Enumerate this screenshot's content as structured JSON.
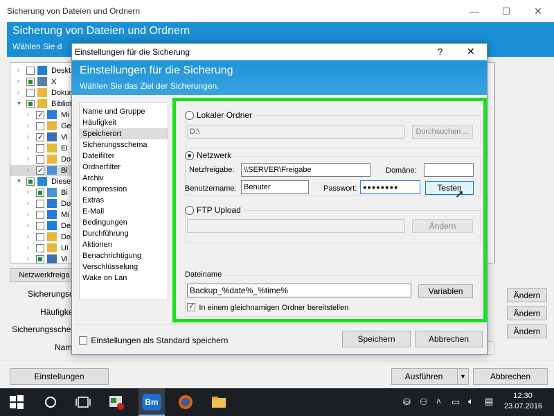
{
  "main": {
    "title": "Sicherung von Dateien und Ordnern",
    "header_title": "Sicherung von Dateien und Ordnern",
    "header_sub": "Wählen Sie d",
    "tree": [
      {
        "label": "Deskt",
        "state": "empty",
        "icon": "desktop-icon"
      },
      {
        "label": "X",
        "state": "fill",
        "icon": "user-icon"
      },
      {
        "label": "Dokur",
        "state": "empty",
        "icon": "folder-icon"
      },
      {
        "label": "Bibliot",
        "state": "fill",
        "icon": "library-icon"
      },
      {
        "label": "Mi",
        "state": "chk",
        "icon": "music-icon"
      },
      {
        "label": "Ge",
        "state": "empty",
        "icon": "folder-icon"
      },
      {
        "label": "Vi",
        "state": "chk",
        "icon": "video-icon"
      },
      {
        "label": "Ei",
        "state": "empty",
        "icon": "folder-icon"
      },
      {
        "label": "Do",
        "state": "empty",
        "icon": "folder-icon"
      },
      {
        "label": "Bi",
        "state": "chk",
        "icon": "pictures-icon"
      },
      {
        "label": "Dieser",
        "state": "fill",
        "icon": "computer-icon"
      },
      {
        "label": "Bi",
        "state": "fill",
        "icon": "pictures-icon"
      },
      {
        "label": "Do",
        "state": "empty",
        "icon": "download-icon"
      },
      {
        "label": "Mi",
        "state": "empty",
        "icon": "music-icon"
      },
      {
        "label": "De",
        "state": "empty",
        "icon": "desktop-icon"
      },
      {
        "label": "Do",
        "state": "empty",
        "icon": "folder-icon"
      },
      {
        "label": "Ui",
        "state": "empty",
        "icon": "folder-icon"
      },
      {
        "label": "Vi",
        "state": "fill",
        "icon": "video-icon"
      }
    ],
    "netzwerkfreigabe_btn": "Netzwerkfreiga",
    "rows": [
      {
        "label": "Sicherungsor",
        "button": "Ändern"
      },
      {
        "label": "Häufigkei",
        "button": "Ändern"
      },
      {
        "label": "Sicherungsschema",
        "button": "Ändern"
      }
    ],
    "name_label": "Nam",
    "einstellungen_btn": "Einstellungen",
    "ausfuehren_btn": "Ausführen",
    "abbrechen_btn": "Abbrechen"
  },
  "dialog": {
    "title": "Einstellungen für die Sicherung",
    "help": "?",
    "close": "✕",
    "header_title": "Einstellungen für die Sicherung",
    "header_sub": "Wählen Sie das Ziel der Sicherungen.",
    "nav": [
      "Name und Gruppe",
      "Häufigkeit",
      "Speicherort",
      "Sicherungsschema",
      "Dateifilter",
      "Ordnerfilter",
      "Archiv",
      "Kompression",
      "Extras",
      "E-Mail",
      "Bedingungen",
      "Durchführung",
      "Aktionen",
      "Benachrichtigung",
      "Verschlüsselung",
      "Wake on Lan"
    ],
    "selected_nav": "Speicherort",
    "lokal": {
      "label": "Lokaler Ordner",
      "path": "D:\\",
      "browse": "Durchsuchen ..."
    },
    "netzwerk": {
      "label": "Netzwerk",
      "share_label": "Netzfreigabe:",
      "share_value": "\\\\SERVER\\Freigabe",
      "domain_label": "Domäne:",
      "domain_value": "",
      "user_label": "Benutzername:",
      "user_value": "Benuter",
      "pass_label": "Passwort:",
      "pass_value": "●●●●●●●●",
      "test_btn": "Testen"
    },
    "ftp": {
      "label": "FTP Upload",
      "value": "",
      "change": "Ändern"
    },
    "filename": {
      "label": "Dateiname",
      "value": "Backup_%date%_%time%",
      "vars_btn": "Variablen",
      "folder_checkbox": "In einem gleichnamigen Ordner bereitstellen"
    },
    "default_checkbox": "Einstellungen als Standard speichern",
    "save_btn": "Speichern",
    "cancel_btn": "Abbrechen"
  },
  "taskbar": {
    "time": "12:30",
    "date": "23.07.2016"
  },
  "colors": {
    "header_blue": "#1a8fd6",
    "highlight_green": "#1be01b",
    "taskbar": "#1b1f23"
  }
}
